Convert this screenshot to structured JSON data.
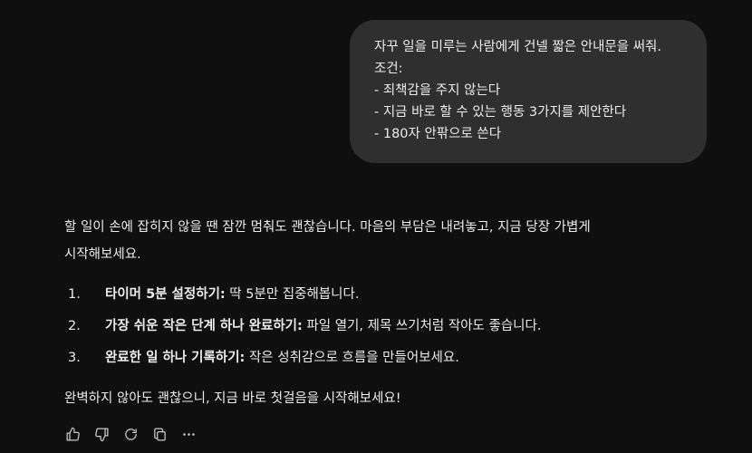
{
  "user_message": {
    "lines": [
      "자꾸 일을 미루는 사람에게 건넬 짧은 안내문을 써줘.",
      "조건:",
      "- 죄책감을 주지 않는다",
      "- 지금 바로 할 수 있는 행동 3가지를 제안한다",
      "- 180자 안팎으로 쓴다"
    ]
  },
  "assistant_message": {
    "intro_line1": "할 일이 손에 잡히지 않을 땐 잠깐 멈춰도 괜찮습니다. 마음의 부담은 내려놓고, 지금 당장 가볍게",
    "intro_line2": "시작해보세요.",
    "steps": [
      {
        "number": "1.",
        "title": "타이머 5분 설정하기:",
        "text": " 딱 5분만 집중해봅니다."
      },
      {
        "number": "2.",
        "title": "가장 쉬운 작은 단계 하나 완료하기:",
        "text": " 파일 열기, 제목 쓰기처럼 작아도 좋습니다."
      },
      {
        "number": "3.",
        "title": "완료한 일 하나 기록하기:",
        "text": " 작은 성취감으로 흐름을 만들어보세요."
      }
    ],
    "outro": "완벽하지 않아도 괜찮으니, 지금 바로 첫걸음을 시작해보세요!"
  },
  "actions": {
    "icons": [
      "thumbs-up-icon",
      "thumbs-down-icon",
      "regenerate-icon",
      "copy-icon",
      "more-icon"
    ]
  }
}
